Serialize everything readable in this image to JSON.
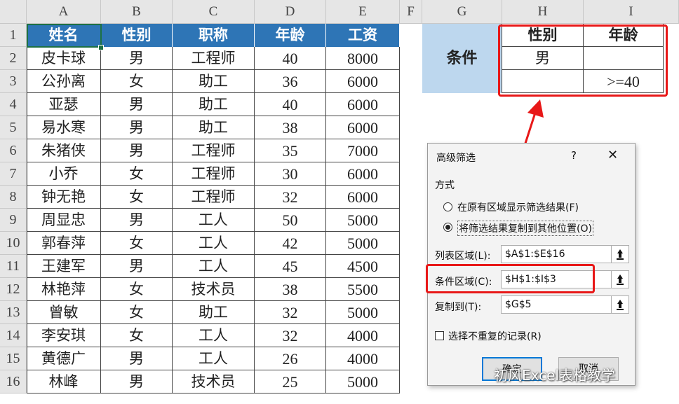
{
  "sheet": {
    "columns": [
      "A",
      "B",
      "C",
      "D",
      "E",
      "F",
      "G",
      "H",
      "I"
    ],
    "rows": [
      "1",
      "2",
      "3",
      "4",
      "5",
      "6",
      "7",
      "8",
      "9",
      "10",
      "11",
      "12",
      "13",
      "14",
      "15",
      "16"
    ],
    "table_headers": [
      "姓名",
      "性别",
      "职称",
      "年龄",
      "工资"
    ],
    "table_rows": [
      [
        "皮卡球",
        "男",
        "工程师",
        "40",
        "8000"
      ],
      [
        "公孙离",
        "女",
        "助工",
        "36",
        "6000"
      ],
      [
        "亚瑟",
        "男",
        "助工",
        "40",
        "6000"
      ],
      [
        "易水寒",
        "男",
        "助工",
        "38",
        "6000"
      ],
      [
        "朱猪侠",
        "男",
        "工程师",
        "35",
        "7000"
      ],
      [
        "小乔",
        "女",
        "工程师",
        "30",
        "6000"
      ],
      [
        "钟无艳",
        "女",
        "工程师",
        "32",
        "6000"
      ],
      [
        "周显忠",
        "男",
        "工人",
        "50",
        "5000"
      ],
      [
        "郭春萍",
        "女",
        "工人",
        "42",
        "5000"
      ],
      [
        "王建军",
        "男",
        "工人",
        "45",
        "4500"
      ],
      [
        "林艳萍",
        "女",
        "技术员",
        "38",
        "5500"
      ],
      [
        "曾敏",
        "女",
        "助工",
        "32",
        "5000"
      ],
      [
        "李安琪",
        "女",
        "工人",
        "32",
        "4000"
      ],
      [
        "黄德广",
        "男",
        "工人",
        "26",
        "4000"
      ],
      [
        "林峰",
        "男",
        "技术员",
        "25",
        "5000"
      ]
    ],
    "criteria": {
      "label": "条件",
      "headers": [
        "性别",
        "年龄"
      ],
      "row2": [
        "男",
        ""
      ],
      "row3": [
        "",
        ">=40"
      ]
    }
  },
  "dialog": {
    "title": "高级筛选",
    "help": "?",
    "close": "✕",
    "group_label": "方式",
    "option1": "在原有区域显示筛选结果(F)",
    "option2": "将筛选结果复制到其他位置(O)",
    "list_label": "列表区域(L):",
    "list_value": "$A$1:$E$16",
    "criteria_label": "条件区域(C):",
    "criteria_value": "$H$1:$I$3",
    "copy_label": "复制到(T):",
    "copy_value": "$G$5",
    "unique_label": "选择不重复的记录(R)",
    "ok": "确定",
    "cancel": "取消"
  },
  "watermark": "初风Excel表格教学",
  "colors": {
    "header_blue": "#2e75b6",
    "criteria_label_bg": "#bdd7ee",
    "highlight_red": "#e81818"
  }
}
